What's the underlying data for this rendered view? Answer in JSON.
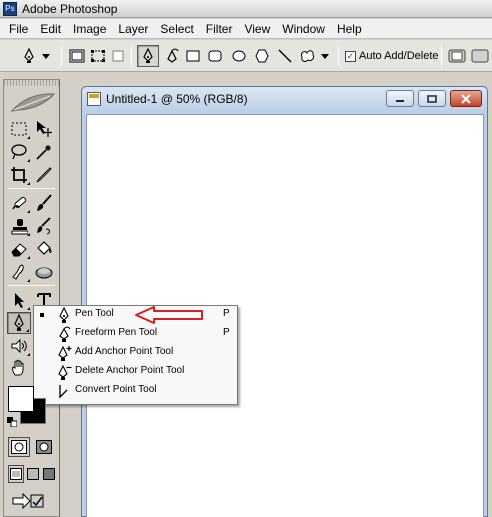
{
  "app": {
    "title": "Adobe Photoshop",
    "logo_icon": "photoshop-logo-icon"
  },
  "menubar": {
    "items": [
      "File",
      "Edit",
      "Image",
      "Layer",
      "Select",
      "Filter",
      "View",
      "Window",
      "Help"
    ]
  },
  "options": {
    "auto_add_delete_label": "Auto Add/Delete",
    "auto_add_delete_checked": true,
    "icons": [
      "pen-preset-icon",
      "chevron-down-icon",
      "shape-layers-icon",
      "paths-icon",
      "fill-pixels-icon",
      "pen-tool-icon",
      "freeform-pen-icon",
      "rectangle-icon",
      "rounded-rectangle-icon",
      "ellipse-icon",
      "polygon-icon",
      "line-icon",
      "custom-shape-icon",
      "chevron-down-icon",
      "combine-mode-icon"
    ]
  },
  "document": {
    "title": "Untitled-1 @ 50% (RGB/8)",
    "controls": [
      "minimize",
      "maximize",
      "close"
    ]
  },
  "flyout": {
    "items": [
      {
        "label": "Pen Tool",
        "shortcut": "P",
        "selected": true,
        "icon": "pen-tool-icon"
      },
      {
        "label": "Freeform Pen Tool",
        "shortcut": "P",
        "selected": false,
        "icon": "freeform-pen-icon"
      },
      {
        "label": "Add Anchor Point Tool",
        "shortcut": "",
        "selected": false,
        "icon": "add-anchor-point-icon"
      },
      {
        "label": "Delete Anchor Point Tool",
        "shortcut": "",
        "selected": false,
        "icon": "delete-anchor-point-icon"
      },
      {
        "label": "Convert Point Tool",
        "shortcut": "",
        "selected": false,
        "icon": "convert-point-icon"
      }
    ]
  },
  "colors": {
    "annotation_arrow": "#d42020",
    "foreground": "#ffffff",
    "background": "#000000",
    "doc_titlebar": "#c7d7ec"
  }
}
